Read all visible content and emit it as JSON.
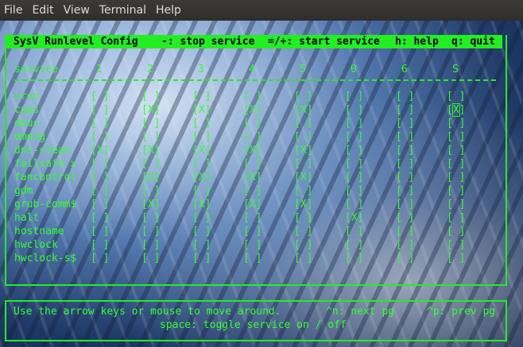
{
  "menubar": {
    "items": [
      "File",
      "Edit",
      "View",
      "Terminal",
      "Help"
    ]
  },
  "header": {
    "title": "SysV Runlevel Config",
    "stop_hint": "-: stop service",
    "start_hint": "=/+: start service",
    "help_hint": "h: help",
    "quit_hint": "q: quit"
  },
  "table": {
    "service_header": "service",
    "runlevels": [
      "1",
      "2",
      "3",
      "4",
      "5",
      "0",
      "6",
      "S"
    ],
    "rows": [
      {
        "name": "cron",
        "states": [
          " ",
          " ",
          " ",
          " ",
          " ",
          " ",
          " ",
          " "
        ]
      },
      {
        "name": "cups",
        "states": [
          " ",
          "X",
          "X",
          "X",
          "X",
          " ",
          " ",
          "X"
        ]
      },
      {
        "name": "dbus",
        "states": [
          " ",
          " ",
          " ",
          " ",
          " ",
          " ",
          " ",
          " "
        ]
      },
      {
        "name": "dmesg",
        "states": [
          " ",
          " ",
          " ",
          " ",
          " ",
          " ",
          " ",
          " "
        ]
      },
      {
        "name": "dns-clean",
        "states": [
          "X",
          "X",
          "X",
          "X",
          "X",
          " ",
          " ",
          " "
        ]
      },
      {
        "name": "failsafe-x",
        "states": [
          " ",
          " ",
          " ",
          " ",
          " ",
          " ",
          " ",
          " "
        ]
      },
      {
        "name": "fancontrol",
        "states": [
          " ",
          "X",
          "X",
          "X",
          "X",
          " ",
          " ",
          " "
        ]
      },
      {
        "name": "gdm",
        "states": [
          " ",
          " ",
          " ",
          " ",
          " ",
          " ",
          " ",
          " "
        ]
      },
      {
        "name": "grub-comm$",
        "states": [
          " ",
          "X",
          "X",
          "X",
          "X",
          " ",
          " ",
          " "
        ]
      },
      {
        "name": "halt",
        "states": [
          " ",
          " ",
          " ",
          " ",
          " ",
          "X",
          " ",
          " "
        ]
      },
      {
        "name": "hostname",
        "states": [
          " ",
          " ",
          " ",
          " ",
          " ",
          " ",
          " ",
          " "
        ]
      },
      {
        "name": "hwclock",
        "states": [
          " ",
          " ",
          " ",
          " ",
          " ",
          " ",
          " ",
          " "
        ]
      },
      {
        "name": "hwclock-s$",
        "states": [
          " ",
          " ",
          " ",
          " ",
          " ",
          " ",
          " ",
          " "
        ]
      }
    ],
    "cursor": {
      "row": 1,
      "col": 7
    }
  },
  "footer": {
    "arrows_hint": "Use the arrow keys or mouse to move around.",
    "next_hint": "^n: next pg",
    "prev_hint": "^p: prev pg",
    "toggle_hint": "space: toggle service on / off"
  },
  "colors": {
    "terminal_text": "#33ff33",
    "titlebar_bg": "#22ee22",
    "menubar_bg": "#3c3b37"
  }
}
